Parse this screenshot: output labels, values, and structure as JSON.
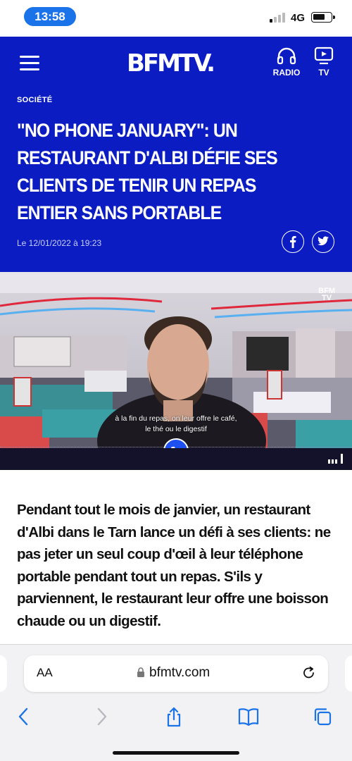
{
  "status_bar": {
    "time": "13:58",
    "network": "4G"
  },
  "header": {
    "logo": "BFMTV.",
    "radio_label": "RADIO",
    "tv_label": "TV",
    "icons": {
      "menu": "hamburger-menu-icon",
      "radio": "headphones-icon",
      "tv": "play-screen-icon"
    },
    "brand_color": "#0b1cc2"
  },
  "article": {
    "category": "SOCIÉTÉ",
    "headline": "\"NO PHONE JANUARY\": UN RESTAURANT D'ALBI DÉFIE SES CLIENTS DE TENIR UN REPAS ENTIER SANS PORTABLE",
    "date": "Le 12/01/2022 à 19:23",
    "share": {
      "facebook": "facebook-icon",
      "twitter": "twitter-icon"
    },
    "lede": "Pendant tout le mois de janvier, un restaurant d'Albi dans le Tarn lance un défi à ses clients: ne pas jeter un seul coup d'œil à leur téléphone portable pendant tout un repas. S'ils y parviennent, le restaurant leur offre une boisson chaude ou un digestif."
  },
  "video": {
    "badge_line1": "BFM",
    "badge_line2": "TV",
    "subtitle_line1": "à la fin du repas, on leur offre le café,",
    "subtitle_line2": "le thé ou le digestif",
    "call_icon": "phone-icon"
  },
  "browser": {
    "text_size_label": "AA",
    "url": "bfmtv.com",
    "toolbar_icons": [
      "back-chevron-icon",
      "forward-chevron-icon",
      "share-icon",
      "bookmarks-book-icon",
      "tabs-icon"
    ]
  }
}
